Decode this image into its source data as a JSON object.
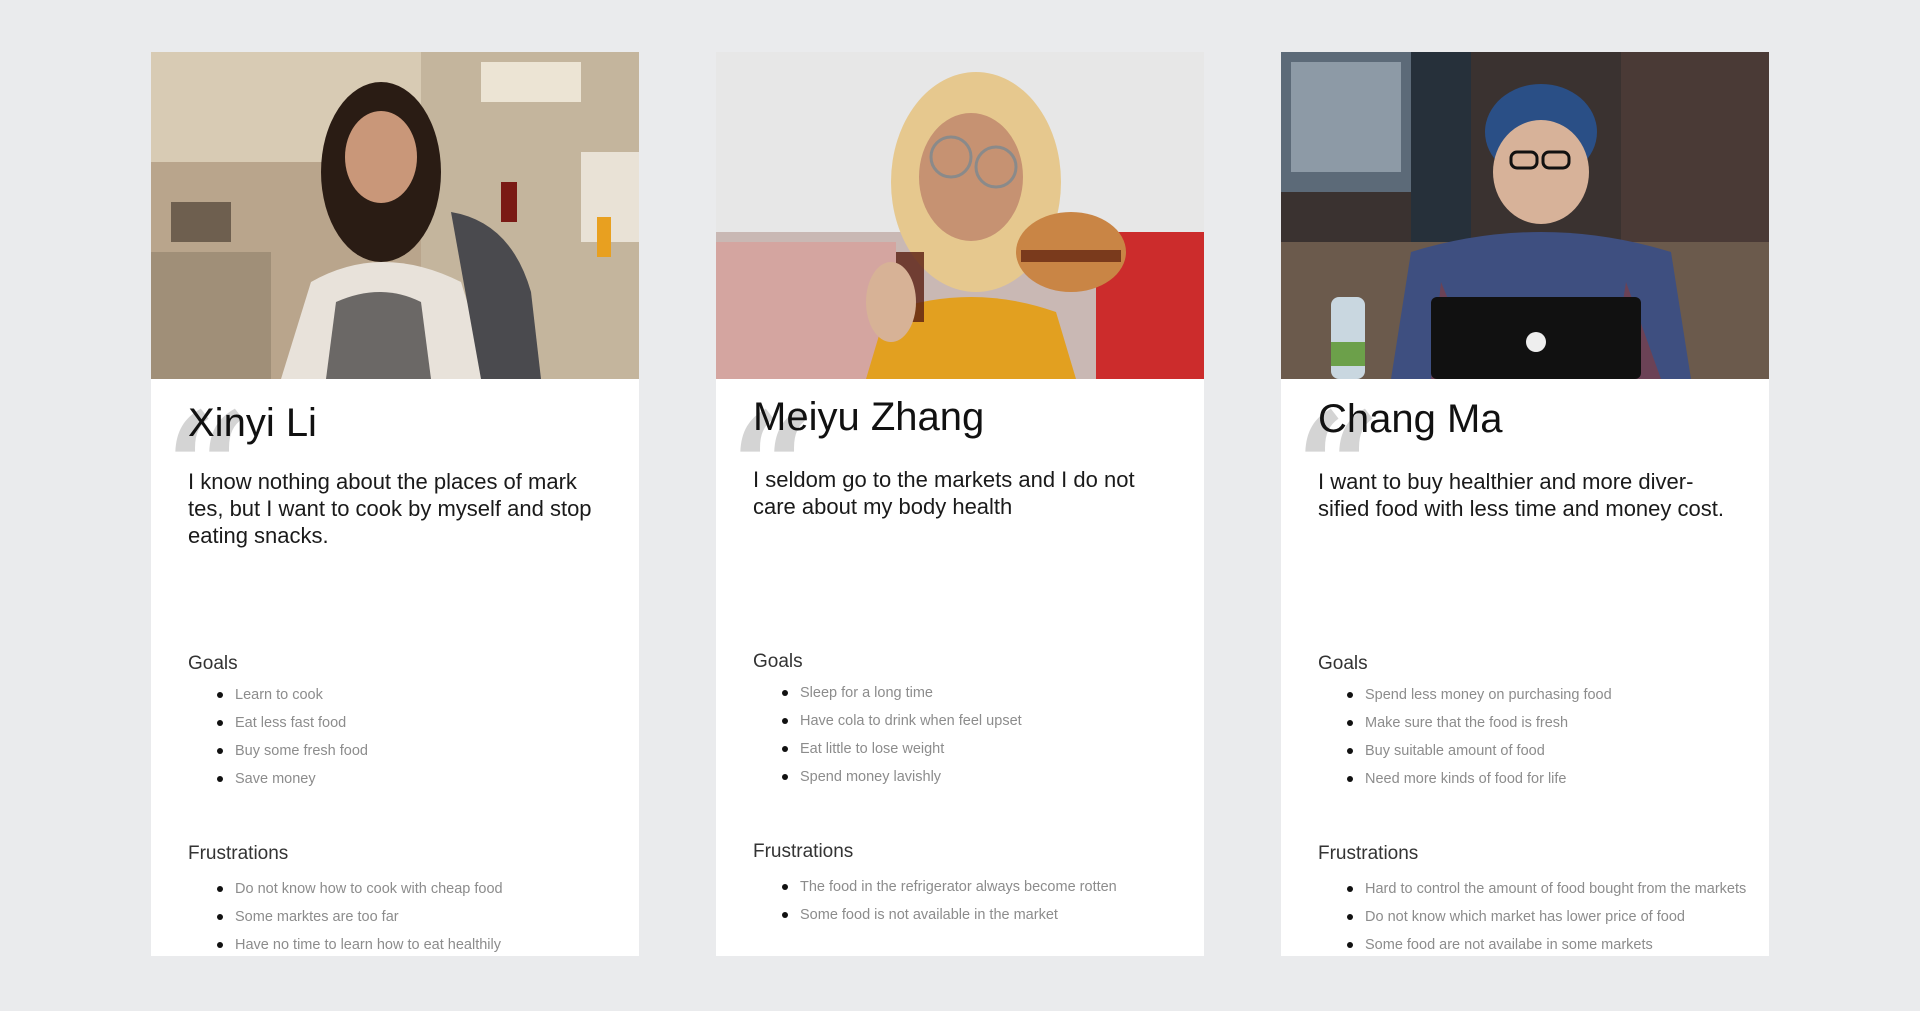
{
  "personas": [
    {
      "name": "Xinyi Li",
      "quote": "I know nothing about the places of mark tes, but I want to cook by myself and stop eating snacks.",
      "goals_title": "Goals",
      "goals": [
        "Learn to cook",
        "Eat less fast food",
        "Buy some fresh food",
        "Save money"
      ],
      "frustrations_title": "Frustrations",
      "frustrations": [
        "Do not know how to cook with cheap food",
        "Some marktes are too far",
        "Have no time to learn how to eat healthily"
      ]
    },
    {
      "name": "Meiyu Zhang",
      "quote": "I seldom go to the markets and I do not care about my body health",
      "goals_title": "Goals",
      "goals": [
        "Sleep for a long time",
        "Have cola to drink when feel upset",
        "Eat little to lose weight",
        "Spend money lavishly"
      ],
      "frustrations_title": "Frustrations",
      "frustrations": [
        "The food in the refrigerator always become rotten",
        "Some food is not available in the market"
      ]
    },
    {
      "name": "Chang Ma",
      "quote": "I want to buy healthier and more diver- sified food with less time and money cost.",
      "goals_title": "Goals",
      "goals": [
        "Spend less money on purchasing food",
        "Make sure that the food is fresh",
        "Buy suitable amount of food",
        "Need more kinds of food for life"
      ],
      "frustrations_title": "Frustrations",
      "frustrations": [
        "Hard to control the amount of food bought from the markets",
        "Do not know which market has lower price of food",
        "Some food are not availabe in some markets"
      ]
    }
  ],
  "quote_glyph": "“",
  "colors": {
    "page_background": "#eaebed",
    "card_background": "#ffffff",
    "quote_mark": "#d4d4d4",
    "list_text": "#8c8c8c"
  }
}
